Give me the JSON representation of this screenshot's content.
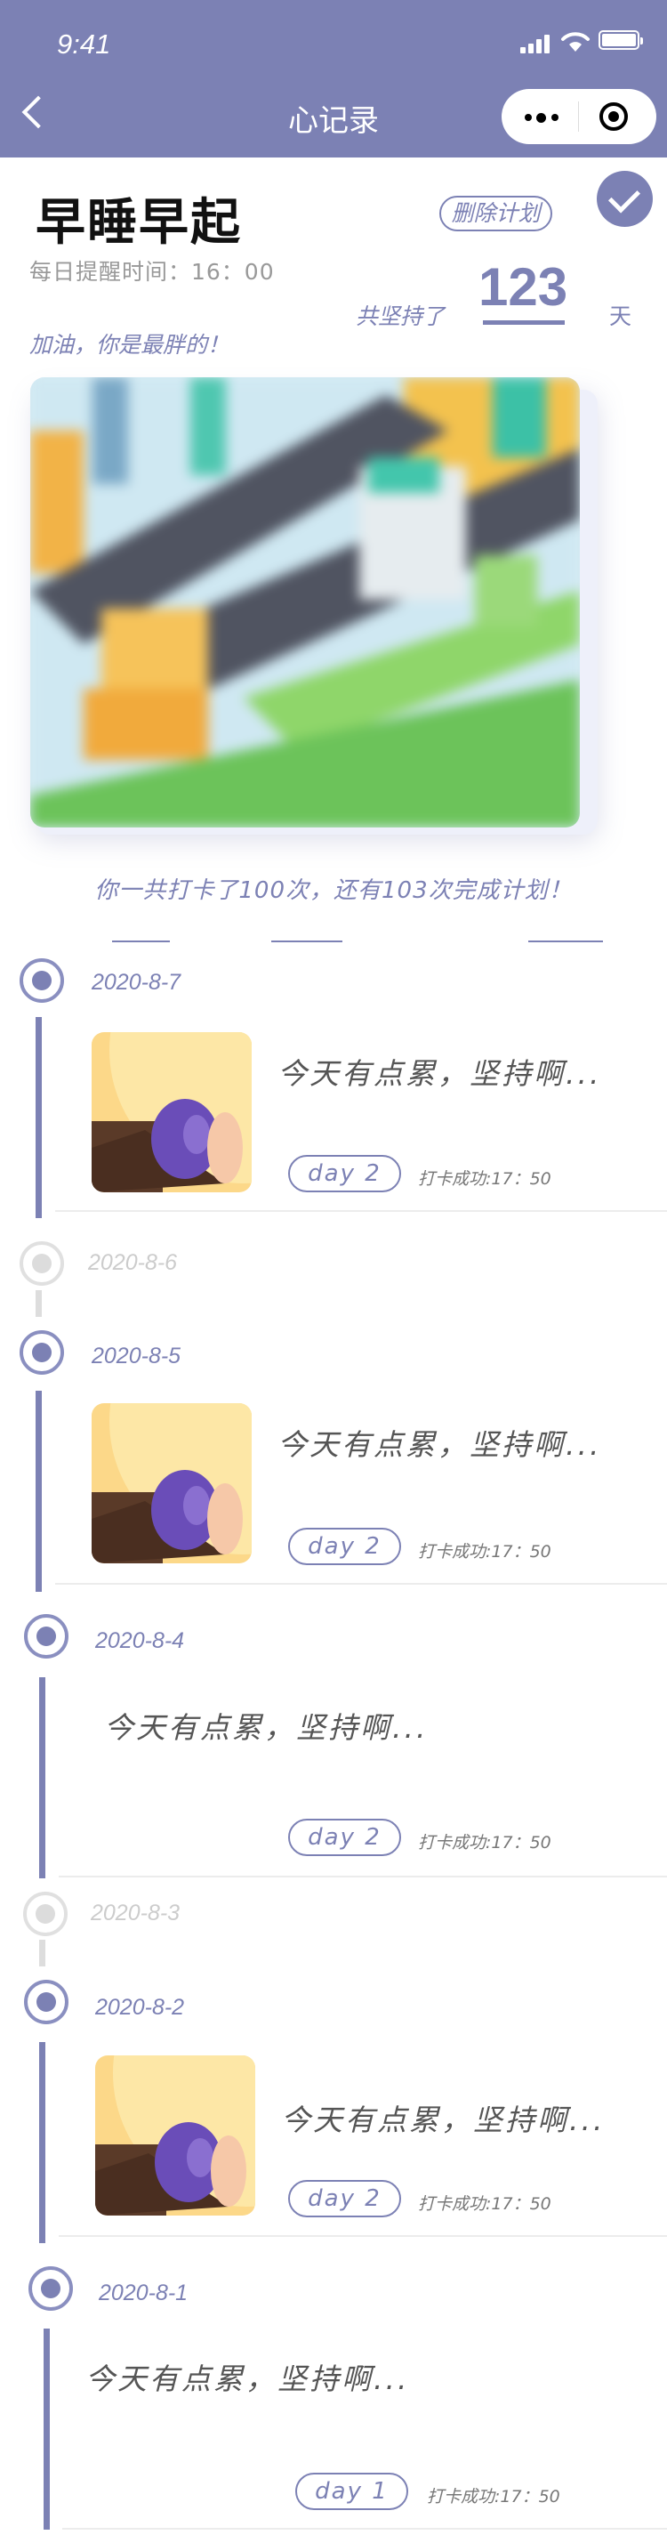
{
  "status_bar": {
    "time": "9:41"
  },
  "nav": {
    "title": "心记录"
  },
  "plan": {
    "title": "早睡早起",
    "delete_label": "删除计划",
    "reminder": "每日提醒时间：16：00",
    "persist_label": "共坚持了",
    "persist_count": "123",
    "persist_unit": "天",
    "encouragement": "加油，你是最胖的！",
    "summary": "你一共打卡了100次，还有103次完成计划！"
  },
  "colors": {
    "primary": "#7c81b4",
    "inactive": "#dddddd"
  },
  "entries": [
    {
      "date": "2020-8-7",
      "text": "今天有点累，坚持啊...",
      "day": "day 2",
      "checkin": "打卡成功:17：50"
    },
    {
      "date": "2020-8-6"
    },
    {
      "date": "2020-8-5",
      "text": "今天有点累，坚持啊...",
      "day": "day 2",
      "checkin": "打卡成功:17：50"
    },
    {
      "date": "2020-8-4",
      "text": "今天有点累，坚持啊...",
      "day": "day 2",
      "checkin": "打卡成功:17：50"
    },
    {
      "date": "2020-8-3"
    },
    {
      "date": "2020-8-2",
      "text": "今天有点累，坚持啊...",
      "day": "day 2",
      "checkin": "打卡成功:17：50"
    },
    {
      "date": "2020-8-1",
      "text": "今天有点累，坚持啊...",
      "day": "day 1",
      "checkin": "打卡成功:17：50"
    }
  ]
}
